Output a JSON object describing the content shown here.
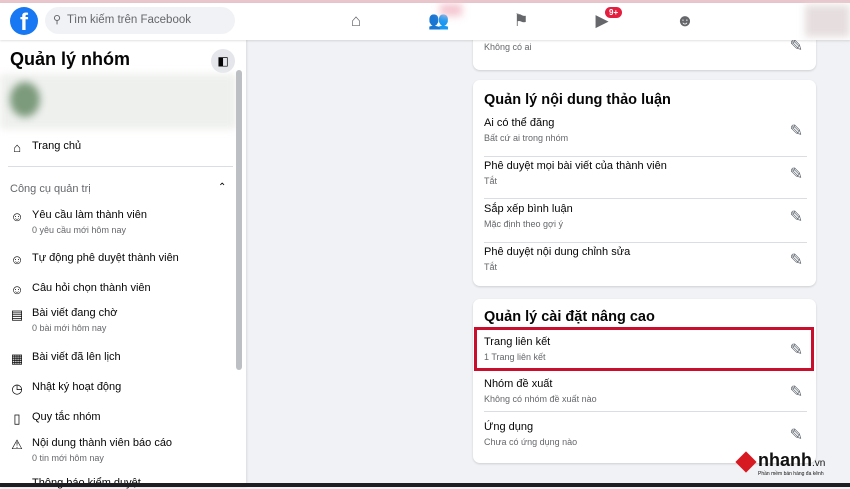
{
  "topbar": {
    "search_placeholder": "Tìm kiếm trên Facebook",
    "video_badge": "9+",
    "logo": "f"
  },
  "sidebar": {
    "title": "Quản lý nhóm",
    "home": "Trang chủ",
    "section": "Công cụ quản trị",
    "items": [
      {
        "label": "Yêu cầu làm thành viên",
        "sub": "0 yêu cầu mới hôm nay",
        "icon": "add-person-icon"
      },
      {
        "label": "Tự động phê duyệt thành viên",
        "icon": "person-check-icon"
      },
      {
        "label": "Câu hỏi chọn thành viên",
        "icon": "person-question-icon"
      },
      {
        "label": "Bài viết đang chờ",
        "sub": "0 bài mới hôm nay",
        "icon": "pending-post-icon"
      },
      {
        "label": "Bài viết đã lên lịch",
        "icon": "calendar-icon"
      },
      {
        "label": "Nhật ký hoạt động",
        "icon": "clock-icon"
      },
      {
        "label": "Quy tắc nhóm",
        "icon": "book-icon"
      },
      {
        "label": "Nội dung thành viên báo cáo",
        "sub": "0 tin mới hôm nay",
        "icon": "report-icon"
      },
      {
        "label": "Thông báo kiểm duyệt",
        "icon": "alert-icon"
      }
    ]
  },
  "main": {
    "top_card": {
      "sub": "Không có ai"
    },
    "discussion": {
      "title": "Quản lý nội dung thảo luận",
      "rows": [
        {
          "label": "Ai có thể đăng",
          "sub": "Bất cứ ai trong nhóm"
        },
        {
          "label": "Phê duyệt mọi bài viết của thành viên",
          "sub": "Tắt"
        },
        {
          "label": "Sắp xếp bình luận",
          "sub": "Mặc định theo gợi ý"
        },
        {
          "label": "Phê duyệt nội dung chỉnh sửa",
          "sub": "Tắt"
        }
      ]
    },
    "advanced": {
      "title": "Quản lý cài đặt nâng cao",
      "rows": [
        {
          "label": "Trang liên kết",
          "sub": "1 Trang liên kết"
        },
        {
          "label": "Nhóm đề xuất",
          "sub": "Không có nhóm đề xuất nào"
        },
        {
          "label": "Ứng dụng",
          "sub": "Chưa có ứng dụng nào"
        }
      ]
    }
  },
  "watermark": {
    "brand": "nhanh",
    "tld": ".vn",
    "tagline": "Phần mềm bán hàng đa kênh"
  },
  "colors": {
    "accent": "#1877f2",
    "highlight": "#c8102e",
    "badge": "#e41e3f"
  }
}
